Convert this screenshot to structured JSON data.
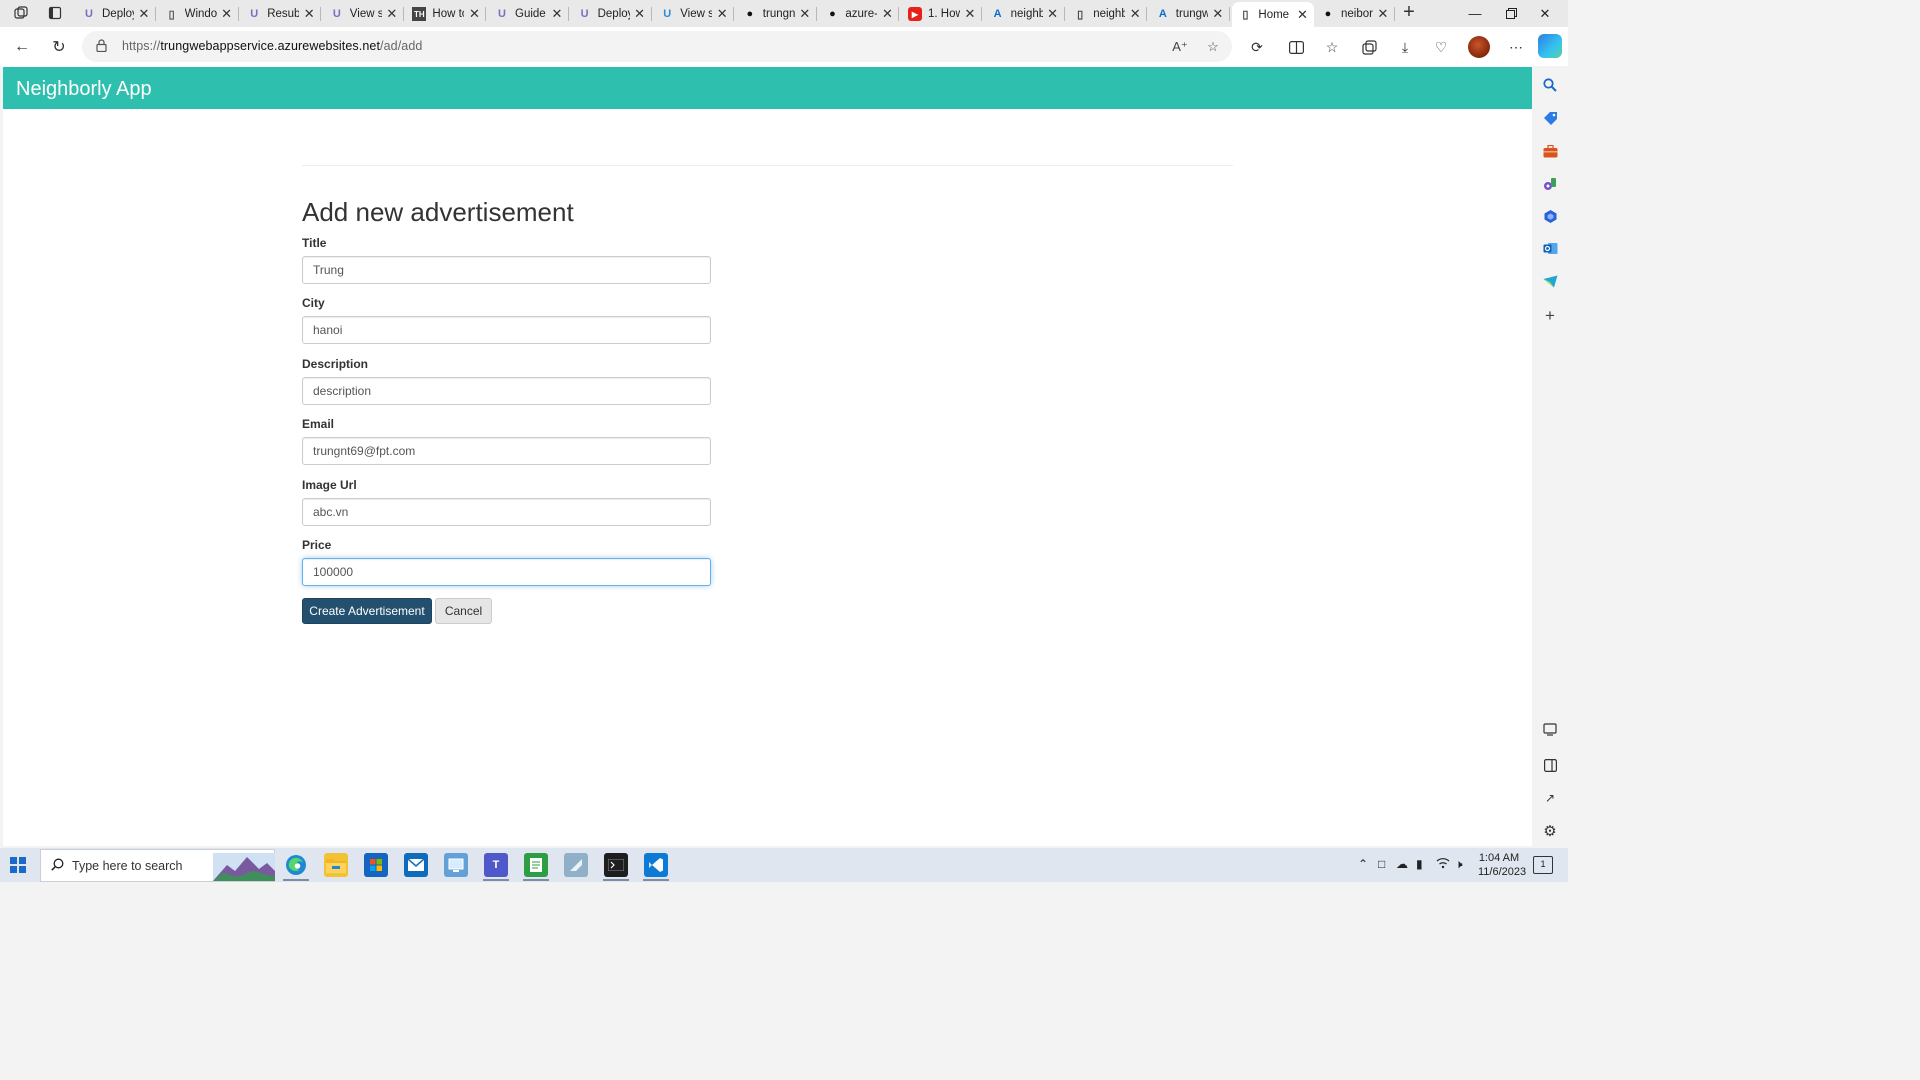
{
  "browser": {
    "tabs": [
      {
        "label": "Deploy",
        "icon": "udacity-icon",
        "color": "#7a6fbf"
      },
      {
        "label": "Windo",
        "icon": "document-icon",
        "color": "#555555"
      },
      {
        "label": "Resubr",
        "icon": "udacity-icon",
        "color": "#7a6fbf"
      },
      {
        "label": "View s",
        "icon": "udacity-icon",
        "color": "#7a6fbf"
      },
      {
        "label": "How to",
        "icon": "th-icon",
        "color": "#444444"
      },
      {
        "label": "Guide",
        "icon": "udacity-icon",
        "color": "#7a6fbf"
      },
      {
        "label": "Deploy",
        "icon": "udacity-icon",
        "color": "#7a6fbf"
      },
      {
        "label": "View s",
        "icon": "udacity-icon",
        "color": "#2e8bcf"
      },
      {
        "label": "trungn",
        "icon": "github-icon",
        "color": "#111111"
      },
      {
        "label": "azure-",
        "icon": "github-icon",
        "color": "#111111"
      },
      {
        "label": "1. How",
        "icon": "youtube-icon",
        "color": "#e62117"
      },
      {
        "label": "neighb",
        "icon": "azure-icon",
        "color": "#0a6fd0"
      },
      {
        "label": "neighb",
        "icon": "document-icon",
        "color": "#444444"
      },
      {
        "label": "trungw",
        "icon": "azure-icon",
        "color": "#0a6fd0"
      },
      {
        "label": "Home",
        "icon": "document-icon",
        "color": "#444444",
        "active": true
      },
      {
        "label": "neibor",
        "icon": "github-icon",
        "color": "#111111"
      }
    ],
    "url_prefix": "https://",
    "url_host": "trungwebappservice.azurewebsites.net",
    "url_path": "/ad/add"
  },
  "app": {
    "brand": "Neighborly App",
    "form_title": "Add new advertisement",
    "fields": [
      {
        "label": "Title",
        "value": "Trung"
      },
      {
        "label": "City",
        "value": "hanoi"
      },
      {
        "label": "Description",
        "value": "description"
      },
      {
        "label": "Email",
        "value": "trungnt69@fpt.com"
      },
      {
        "label": "Image Url",
        "value": "abc.vn"
      },
      {
        "label": "Price",
        "value": "100000",
        "focused": true
      }
    ],
    "submit_label": "Create Advertisement",
    "cancel_label": "Cancel"
  },
  "taskbar": {
    "search_placeholder": "Type here to search",
    "time": "1:04 AM",
    "date": "11/6/2023",
    "notification_count": "1"
  },
  "colors": {
    "header_bg": "#2fbfae",
    "primary_button": "#23506e",
    "focus_border": "#66afe9"
  }
}
